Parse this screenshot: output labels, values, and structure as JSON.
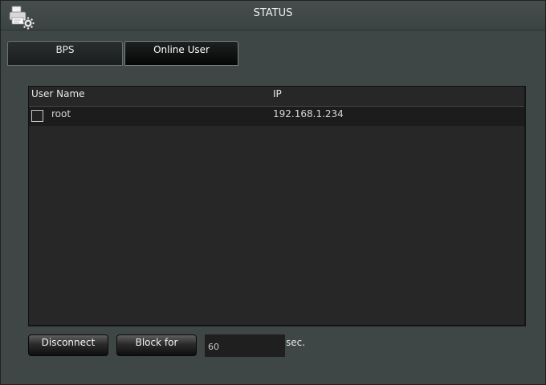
{
  "window": {
    "title": "STATUS"
  },
  "icons": {
    "title": "printer-gear-icon"
  },
  "tabs": [
    {
      "label": "BPS",
      "active": false
    },
    {
      "label": "Online User",
      "active": true
    }
  ],
  "table": {
    "columns": [
      "User Name",
      "IP"
    ],
    "rows": [
      {
        "checked": false,
        "user": "root",
        "ip": "192.168.1.234"
      }
    ]
  },
  "controls": {
    "disconnect_label": "Disconnect",
    "block_label": "Block for",
    "block_value": "60",
    "unit_label": "sec."
  },
  "colors": {
    "background": "#3e4646",
    "table_bg": "#272727",
    "row_bg": "#1c1c1c"
  }
}
